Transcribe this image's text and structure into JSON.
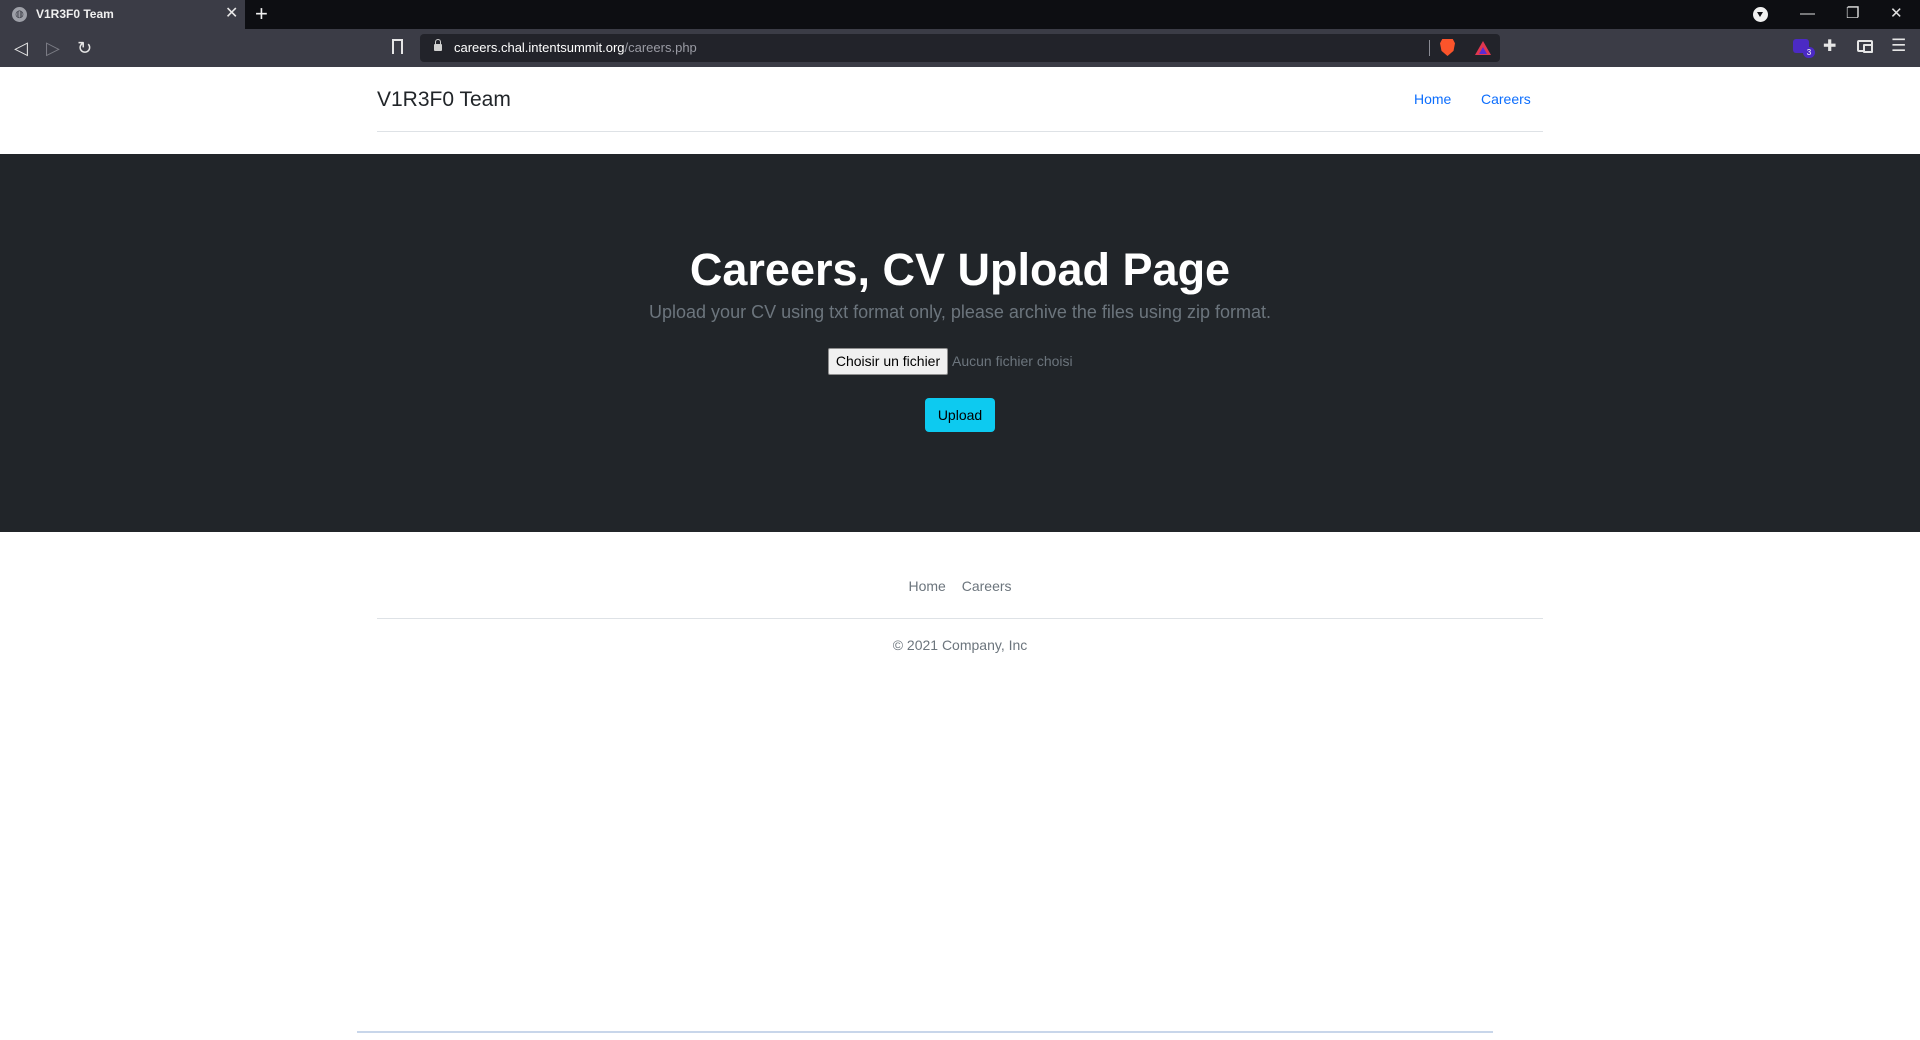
{
  "browser": {
    "tab_title": "V1R3F0 Team",
    "url_host": "careers.chal.intentsummit.org",
    "url_path": "/careers.php",
    "extension_badge_count": "3"
  },
  "header": {
    "brand": "V1R3F0 Team",
    "nav": {
      "home": "Home",
      "careers": "Careers"
    }
  },
  "hero": {
    "title": "Careers, CV Upload Page",
    "subtitle": "Upload your CV using txt format only, please archive the files using zip format.",
    "file_button_label": "Choisir un fichier",
    "file_status": "Aucun fichier choisi",
    "upload_label": "Upload",
    "colors": {
      "background": "#212529",
      "upload_button": "#0dcaf0"
    }
  },
  "footer": {
    "links": {
      "home": "Home",
      "careers": "Careers"
    },
    "copyright": "© 2021 Company, Inc"
  }
}
